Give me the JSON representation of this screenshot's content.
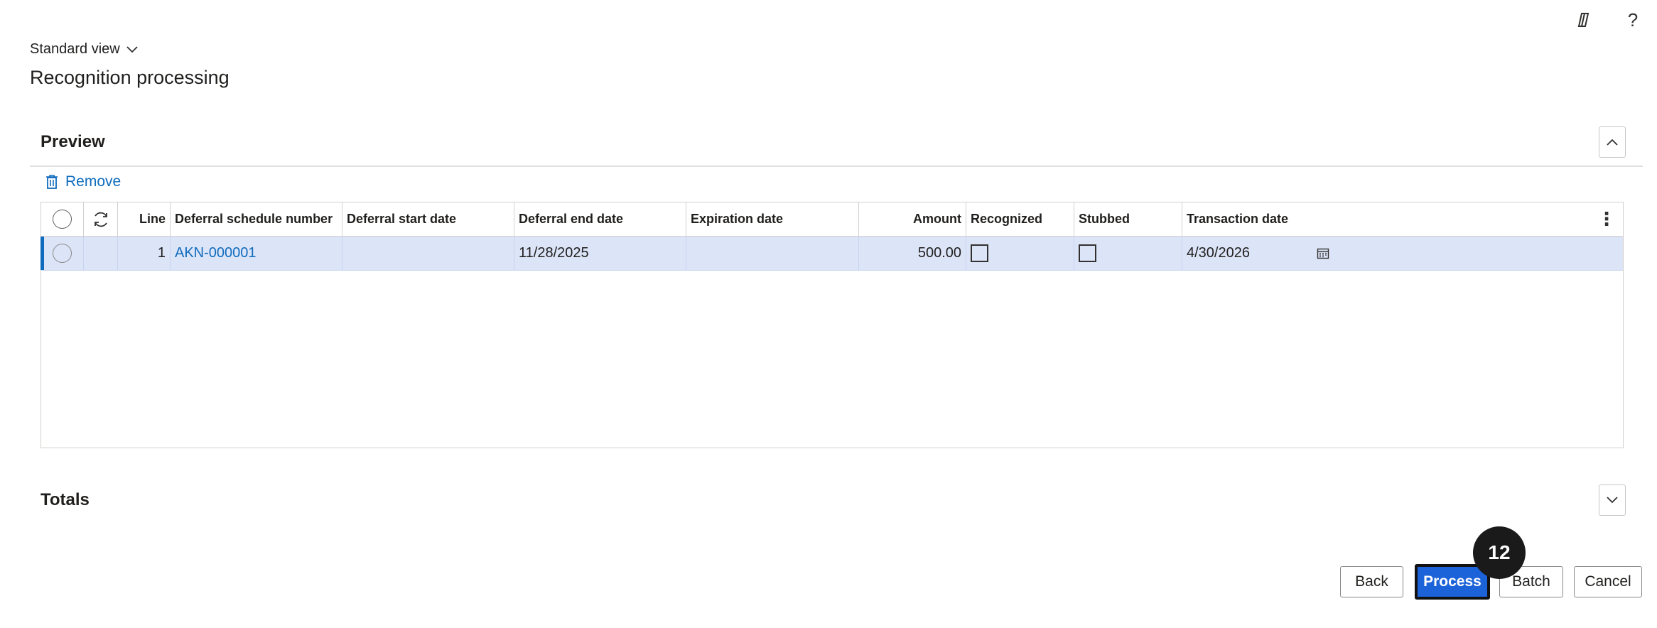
{
  "header": {
    "view_label": "Standard view",
    "page_title": "Recognition processing",
    "copilot_icon": "copilot-icon",
    "help_glyph": "?"
  },
  "preview": {
    "title": "Preview",
    "remove_label": "Remove",
    "columns": {
      "line": "Line",
      "deferral_schedule_number": "Deferral schedule number",
      "deferral_start_date": "Deferral start date",
      "deferral_end_date": "Deferral end date",
      "expiration_date": "Expiration date",
      "amount": "Amount",
      "recognized": "Recognized",
      "stubbed": "Stubbed",
      "transaction_date": "Transaction date"
    },
    "rows": [
      {
        "line": "1",
        "deferral_schedule_number": "AKN-000001",
        "deferral_start_date": "",
        "deferral_end_date": "11/28/2025",
        "expiration_date": "",
        "amount": "500.00",
        "recognized": false,
        "stubbed": false,
        "transaction_date": "4/30/2026"
      }
    ]
  },
  "totals": {
    "title": "Totals"
  },
  "footer": {
    "back_label": "Back",
    "process_label": "Process",
    "batch_label": "Batch",
    "cancel_label": "Cancel",
    "step_badge": "12"
  },
  "colors": {
    "accent": "#0f6cbd",
    "primary_button": "#1c62d9",
    "selected_row": "#dce4f8"
  }
}
